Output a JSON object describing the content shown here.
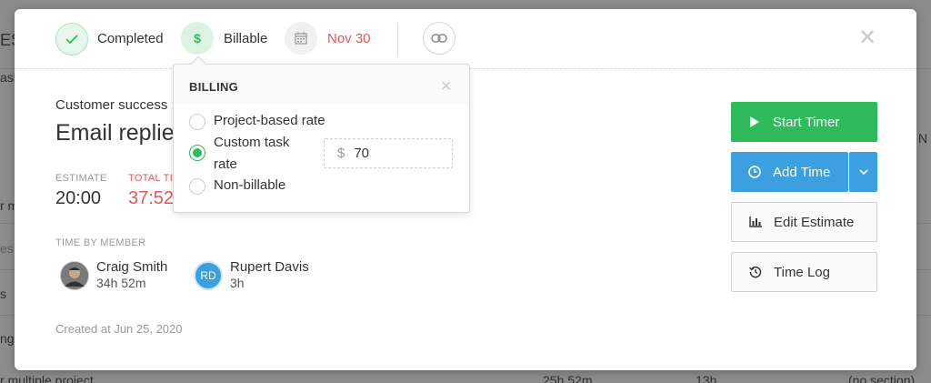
{
  "background": {
    "left_fragments": [
      "EST",
      "ask",
      "r m",
      "es",
      "s",
      "ngs",
      "r multiple project"
    ],
    "right_fragments": [
      "N",
      "25h 52m",
      "13h",
      "(no section)"
    ]
  },
  "topbar": {
    "completed_label": "Completed",
    "billable_label": "Billable",
    "billable_symbol": "$",
    "due_date": "Nov 30",
    "close_symbol": "✕"
  },
  "task": {
    "project": "Customer success :",
    "title": "Email replie"
  },
  "stats": {
    "estimate_label": "ESTIMATE",
    "estimate_value": "20:00",
    "total_label": "TOTAL TI",
    "total_value": "37:52"
  },
  "members": {
    "heading": "TIME BY MEMBER",
    "list": [
      {
        "name": "Craig Smith",
        "time": "34h 52m",
        "initials": ""
      },
      {
        "name": "Rupert Davis",
        "time": "3h",
        "initials": "RD"
      }
    ]
  },
  "created": "Created at Jun 25, 2020",
  "actions": {
    "start_timer": "Start Timer",
    "add_time": "Add Time",
    "edit_estimate": "Edit Estimate",
    "time_log": "Time Log"
  },
  "billing": {
    "title": "BILLING",
    "close_symbol": "✕",
    "options": {
      "project_rate": "Project-based rate",
      "custom_rate_line1": "Custom task",
      "custom_rate_line2": "rate",
      "non_billable": "Non-billable"
    },
    "selected": "custom",
    "currency_symbol": "$",
    "rate_value": "70"
  },
  "colors": {
    "accent_green": "#2fba5c",
    "accent_blue": "#3b9fe0",
    "overdue_red": "#e05a5a"
  }
}
